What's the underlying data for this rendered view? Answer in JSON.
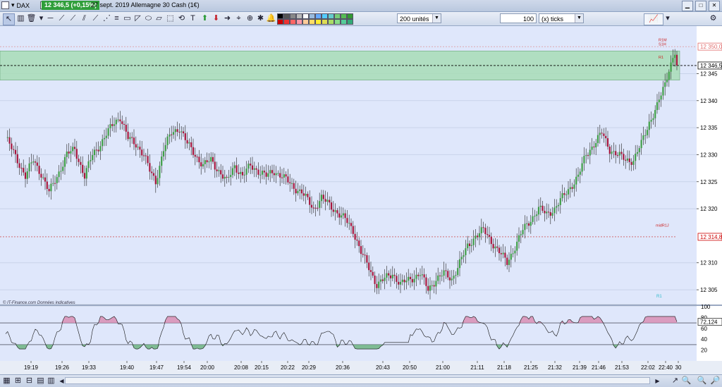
{
  "titlebar": {
    "symbol": "DAX",
    "price_badge": "12 346,5 (+0,15%)",
    "description": "27 sept. 2019 Allemagne 30 Cash (1€)"
  },
  "toolbar": {
    "units_value": "200 unités",
    "ticks_amount": "100",
    "ticks_unit": "(x) ticks"
  },
  "chart": {
    "price_axis_labels": [
      "12 345",
      "12 340",
      "12 335",
      "12 330",
      "12 325",
      "12 320",
      "12 310",
      "12 305"
    ],
    "price_axis_values": [
      12345,
      12340,
      12335,
      12330,
      12325,
      12320,
      12310,
      12305
    ],
    "badges": [
      {
        "label": "12 350,0",
        "value": 12350.0,
        "color": "#e06a6a"
      },
      {
        "label": "12 346,5",
        "value": 12346.5,
        "color": "#000000"
      },
      {
        "label": "12 314,8",
        "value": 12314.8,
        "color": "#cc0000"
      }
    ],
    "level_labels": [
      {
        "text": "R1M",
        "value": 12351.0
      },
      {
        "text": "S1H",
        "value": 12350.2
      },
      {
        "text": "R1",
        "value": 12347.8
      },
      {
        "text": "midR1J",
        "value": 12316.7
      }
    ],
    "copyright": "© IT-Finance.com  Données indicatives",
    "bottom_tag": "R1",
    "resistance_zone": [
      12343.8,
      12349.2
    ],
    "price_range": [
      12302.4,
      12353.8
    ],
    "up_color": "#3f9e47",
    "down_color": "#a8153c",
    "background": "#dfe7fb"
  },
  "oscillator": {
    "axis_labels": [
      "100",
      "80",
      "60",
      "40",
      "20"
    ],
    "axis_values": [
      100,
      80,
      60,
      40,
      20
    ],
    "current_label": "72,124",
    "current_value": 72.124,
    "levels": [
      70,
      30
    ]
  },
  "time_axis": {
    "labels": [
      "19:19",
      "19:26",
      "19:33",
      "19:40",
      "19:47",
      "19:54",
      "20:00",
      "20:08",
      "20:15",
      "20:22",
      "20:29",
      "20:36",
      "20:43",
      "20:50",
      "21:00",
      "21:11",
      "21:18",
      "21:25",
      "21:32",
      "21:39",
      "21:46",
      "21:53",
      "22:02",
      "22:40",
      "30"
    ]
  }
}
